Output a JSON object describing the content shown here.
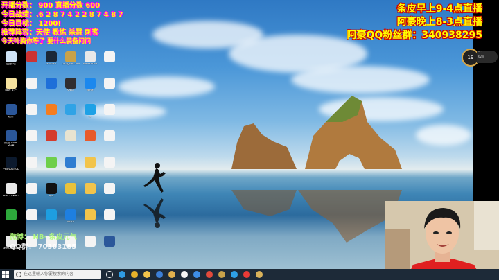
{
  "stream_overlay": {
    "left_lines": [
      "开播分数：  900  直播分数  600",
      "今日战绩：.6 2 8 7 4 2 2 8 7 4 8 7",
      "今日目标：  1200!",
      "推荐阵容：天使 教练 杀戮 刺客",
      "今天叶胸你等了 要什么装备问问"
    ],
    "right_lines": [
      "条皮早上9-4点直播",
      "阿豪晚上8-3点直播",
      "阿豪QQ粉丝群：340938295"
    ],
    "watermark_weibo": "微博：  NB·   条皮元气",
    "watermark_qq": "QQ群：  70303185"
  },
  "weather": {
    "temp": "19",
    "sub1": "°C",
    "sub2": "62%"
  },
  "desktop_icons": [
    {
      "label": "回收站",
      "color": "#cfe3f5"
    },
    {
      "label": "",
      "color": "#c33"
    },
    {
      "label": "Steam",
      "color": "#1b2838"
    },
    {
      "label": "LeagueClient",
      "color": "#c8a24a"
    },
    {
      "label": "WeGame",
      "color": "#e8e8e8"
    },
    {
      "label": "",
      "color": "#f4f4f4"
    },
    {
      "label": "博客文档",
      "color": "#f6e3a0"
    },
    {
      "label": "",
      "color": "#f4f4f4"
    },
    {
      "label": "",
      "color": "#1e6fd9"
    },
    {
      "label": "OBS",
      "color": "#302e31"
    },
    {
      "label": "酷狗",
      "color": "#1b88ee"
    },
    {
      "label": "",
      "color": "#f4f4f4"
    },
    {
      "label": "软件",
      "color": "#2b579a"
    },
    {
      "label": "",
      "color": "#f4f4f4"
    },
    {
      "label": "",
      "color": "#f57d1f"
    },
    {
      "label": "",
      "color": "#30a3e6"
    },
    {
      "label": "IE",
      "color": "#1ea1e6"
    },
    {
      "label": "",
      "color": "#f4f4f4"
    },
    {
      "label": "新建 DOC 文档",
      "color": "#2b579a"
    },
    {
      "label": "",
      "color": "#f4f4f4"
    },
    {
      "label": "",
      "color": "#d43c2c"
    },
    {
      "label": "",
      "color": "#e8e3d0"
    },
    {
      "label": "",
      "color": "#e85b2c"
    },
    {
      "label": "",
      "color": "#f4f4f4"
    },
    {
      "label": "Photoshop",
      "color": "#0c1a2e"
    },
    {
      "label": "",
      "color": "#f4f4f4"
    },
    {
      "label": "",
      "color": "#6fcf4a"
    },
    {
      "label": "",
      "color": "#2f7dd1"
    },
    {
      "label": "",
      "color": "#f2c44b"
    },
    {
      "label": "",
      "color": "#f4f4f4"
    },
    {
      "label": "08F7326A",
      "color": "#e9e9e9"
    },
    {
      "label": "",
      "color": "#f4f4f4"
    },
    {
      "label": "QQ",
      "color": "#111"
    },
    {
      "label": "",
      "color": "#e9c23b"
    },
    {
      "label": "",
      "color": "#f2c44b"
    },
    {
      "label": "",
      "color": "#f4f4f4"
    },
    {
      "label": "",
      "color": "#2da83b"
    },
    {
      "label": "",
      "color": "#f4f4f4"
    },
    {
      "label": "",
      "color": "#1e9ee0"
    },
    {
      "label": "WPS",
      "color": "#1e7fe0"
    },
    {
      "label": "",
      "color": "#f2c44b"
    },
    {
      "label": "",
      "color": "#f4f4f4"
    },
    {
      "label": "3065050A",
      "color": "#e9e9e9"
    },
    {
      "label": "",
      "color": "#f4f4f4"
    },
    {
      "label": "",
      "color": "#f4f4f4"
    },
    {
      "label": "",
      "color": "#f4f4f4"
    },
    {
      "label": "",
      "color": "#f4f4f4"
    },
    {
      "label": "",
      "color": "#2b579a"
    }
  ],
  "taskbar": {
    "search_placeholder": "在这里输入你要搜索的内容",
    "pinned": [
      {
        "name": "task-view-icon",
        "color": "#ffffff"
      },
      {
        "name": "edge-icon",
        "color": "#2f9be3"
      },
      {
        "name": "chrome-icon",
        "color": "#e9b32a"
      },
      {
        "name": "file-explorer-icon",
        "color": "#f2c44b"
      },
      {
        "name": "store-icon",
        "color": "#3c7fd6"
      },
      {
        "name": "app-icon-1",
        "color": "#e0b04d"
      },
      {
        "name": "app-icon-2",
        "color": "#f4f4f4"
      },
      {
        "name": "app-icon-3",
        "color": "#3e8ee6"
      },
      {
        "name": "app-icon-4",
        "color": "#e14a3b"
      },
      {
        "name": "app-icon-5",
        "color": "#c8a24a"
      },
      {
        "name": "app-icon-6",
        "color": "#2ea0e6"
      },
      {
        "name": "app-icon-7",
        "color": "#e83a36"
      },
      {
        "name": "app-icon-8",
        "color": "#d9b25a"
      }
    ]
  }
}
